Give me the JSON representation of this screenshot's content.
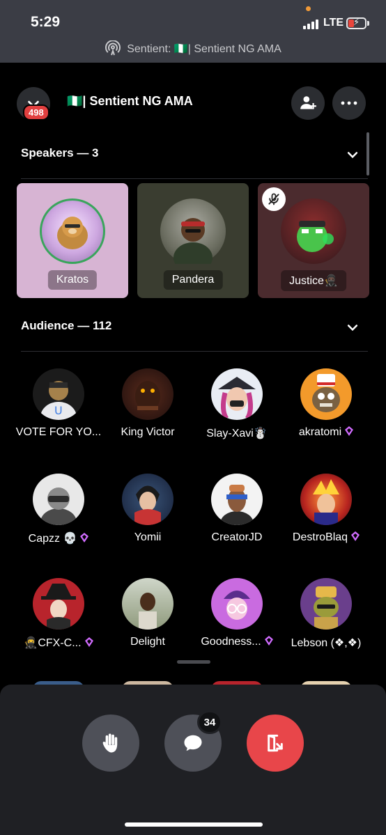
{
  "status_bar": {
    "time": "5:29",
    "network": "LTE",
    "battery_level": 0.2
  },
  "banner": {
    "text": "Sentient: 🇳🇬| Sentient NG AMA"
  },
  "header": {
    "title": "🇳🇬| Sentient NG AMA",
    "notification_badge": "498"
  },
  "speakers": {
    "title": "Speakers — 3",
    "items": [
      {
        "name": "Kratos",
        "bg": "#d7b4d3"
      },
      {
        "name": "Pandera",
        "bg": "#3a3d30"
      },
      {
        "name": "Justice🥷🏿",
        "bg": "#4b2b2e",
        "muted": true
      }
    ]
  },
  "audience": {
    "title": "Audience — 112",
    "items": [
      {
        "name": "VOTE FOR YO...",
        "badge": false
      },
      {
        "name": "King Victor",
        "badge": false
      },
      {
        "name": "Slay-Xavi☃️",
        "badge": false
      },
      {
        "name": "akratomi",
        "badge": true
      },
      {
        "name": "Capzz 💀",
        "badge": true
      },
      {
        "name": "Yomii",
        "badge": false
      },
      {
        "name": "CreatorJD",
        "badge": false
      },
      {
        "name": "DestroBlaq",
        "badge": true
      },
      {
        "name": "🥷CFX-C...",
        "badge": true
      },
      {
        "name": "Delight",
        "badge": false
      },
      {
        "name": "Goodness...",
        "badge": true
      },
      {
        "name": "Lebson (❖,❖)",
        "badge": false
      }
    ]
  },
  "controls": {
    "chat_count": "34"
  },
  "colors": {
    "accent_red": "#e13f3f",
    "leave_red": "#e8464a",
    "nitro_purple": "#d16cff"
  }
}
